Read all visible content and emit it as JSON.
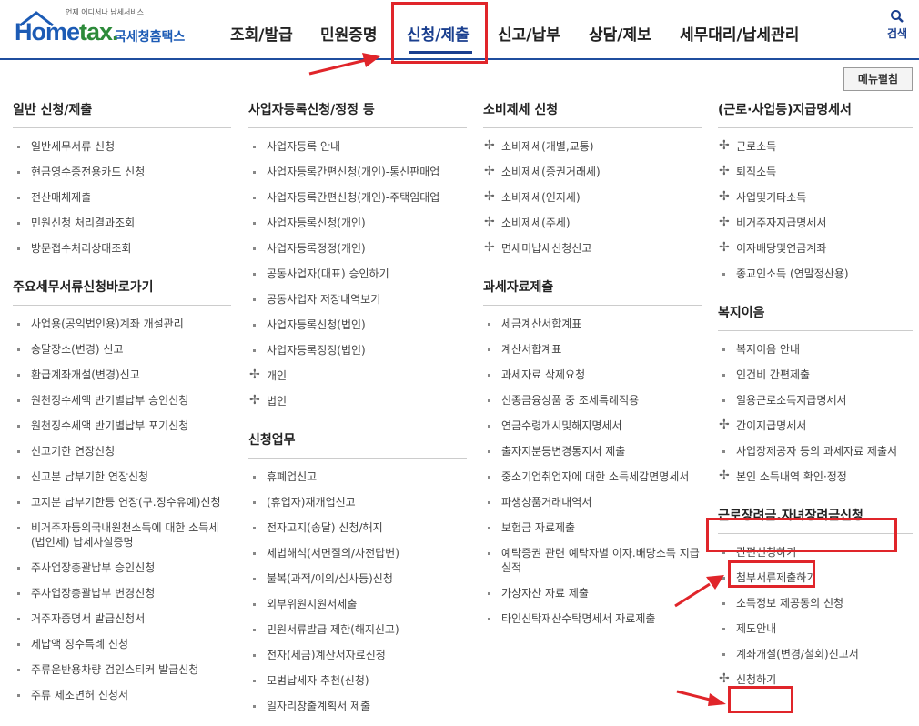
{
  "header": {
    "logo_tag": "언제 어디서나 납세서비스",
    "logo_home": "Home",
    "logo_tax": "tax.",
    "logo_korean": "국세청홈택스",
    "nav": [
      "조회/발급",
      "민원증명",
      "신청/제출",
      "신고/납부",
      "상담/제보",
      "세무대리/납세관리"
    ],
    "search_label": "검색"
  },
  "menu_toggle": "메뉴펼침",
  "columns": {
    "col1": {
      "sections": [
        {
          "title": "일반 신청/제출",
          "items": [
            "일반세무서류 신청",
            "현금영수증전용카드 신청",
            "전산매체제출",
            "민원신청 처리결과조회",
            "방문접수처리상태조회"
          ]
        },
        {
          "title": "주요세무서류신청바로가기",
          "items": [
            "사업용(공익법인용)계좌 개설관리",
            "송달장소(변경) 신고",
            "환급계좌개설(변경)신고",
            "원천징수세액 반기별납부 승인신청",
            "원천징수세액 반기별납부 포기신청",
            "신고기한 연장신청",
            "신고분 납부기한 연장신청",
            "고지분 납부기한등 연장(구.징수유예)신청",
            "비거주자등의국내원천소득에 대한 소득세(법인세) 납세사실증명",
            "주사업장총괄납부 승인신청",
            "주사업장총괄납부 변경신청",
            "거주자증명서 발급신청서",
            "제납액 징수특례 신청",
            "주류운반용차량 검인스티커 발급신청",
            "주류 제조면허 신청서"
          ]
        }
      ]
    },
    "col2": {
      "sections": [
        {
          "title": "사업자등록신청/정정 등",
          "items": [
            "사업자등록 안내",
            "사업자등록간편신청(개인)-통신판매업",
            "사업자등록간편신청(개인)-주택임대업",
            "사업자등록신청(개인)",
            "사업자등록정정(개인)",
            "공동사업자(대표) 승인하기",
            "공동사업자 저장내역보기",
            "사업자등록신청(법인)",
            "사업자등록정정(법인)"
          ],
          "plus_items": [
            "개인",
            "법인"
          ]
        },
        {
          "title": "신청업무",
          "items": [
            "휴폐업신고",
            "(휴업자)재개업신고",
            "전자고지(송달) 신청/해지",
            "세법해석(서면질의/사전답변)",
            "불복(과적/이의/심사등)신청",
            "외부위원지원서제출",
            "민원서류발급 제한(해지신고)",
            "전자(세금)계산서자료신청",
            "모범납세자 추천(신청)",
            "일자리창출계획서 제출"
          ]
        }
      ]
    },
    "col3": {
      "sections": [
        {
          "title": "소비제세 신청",
          "plus_items": [
            "소비제세(개별,교통)",
            "소비제세(증권거래세)",
            "소비제세(인지세)",
            "소비제세(주세)",
            "면세미납세신청신고"
          ]
        },
        {
          "title": "과세자료제출",
          "items": [
            "세금계산서합계표",
            "계산서합계표",
            "과세자료 삭제요청",
            "신종금융상품 중 조세특례적용",
            "연금수령개시및해지명세서",
            "출자지분등변경통지서 제출",
            "중소기업취업자에 대한 소득세감면명세서",
            "파생상품거래내역서",
            "보험금 자료제출",
            "예탁증권 관련 예탁자별 이자.배당소득 지급 실적",
            "가상자산 자료 제출",
            "타인신탁재산수탁명세서 자료제출"
          ]
        }
      ]
    },
    "col4": {
      "sections": [
        {
          "title": "(근로·사업등)지급명세서",
          "plus_items": [
            "근로소득",
            "퇴직소득",
            "사업및기타소득",
            "비거주자지급명세서",
            "이자배당및연금계좌"
          ],
          "items": [
            "종교인소득 (연말정산용)"
          ]
        },
        {
          "title": "복지이음",
          "items": [
            "복지이음 안내",
            "인건비 간편제출",
            "일용근로소득지급명세서"
          ],
          "plus_items": [
            "간이지급명세서"
          ],
          "items2": [
            "사업장제공자 등의 과세자료 제출서"
          ],
          "plus_items2": [
            "본인 소득내역 확인·정정"
          ]
        },
        {
          "title": "근로장려금.자녀장려금신청",
          "items": [
            "간편신청하기",
            "첨부서류제출하기",
            "소득정보 제공동의 신청",
            "제도안내",
            "계좌개설(변경/철회)신고서"
          ],
          "plus_items": [
            "신청하기"
          ]
        }
      ]
    }
  },
  "annotations": {
    "highlight_color": "#e0252a"
  }
}
